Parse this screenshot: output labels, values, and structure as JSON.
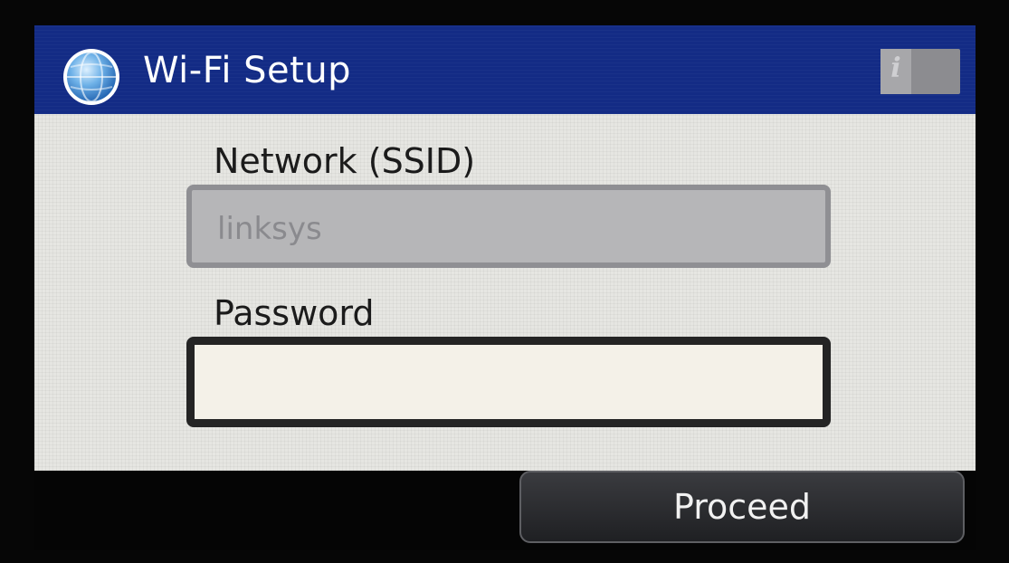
{
  "header": {
    "title": "Wi-Fi Setup",
    "icon": "globe-icon",
    "info_icon": "i",
    "colors": {
      "header_bg": "#132b85",
      "body_bg": "#e6e6e2",
      "footer_bg": "#050505"
    }
  },
  "form": {
    "ssid_label": "Network (SSID)",
    "ssid_value": "linksys",
    "password_label": "Password",
    "password_value": ""
  },
  "footer": {
    "proceed_label": "Proceed"
  }
}
